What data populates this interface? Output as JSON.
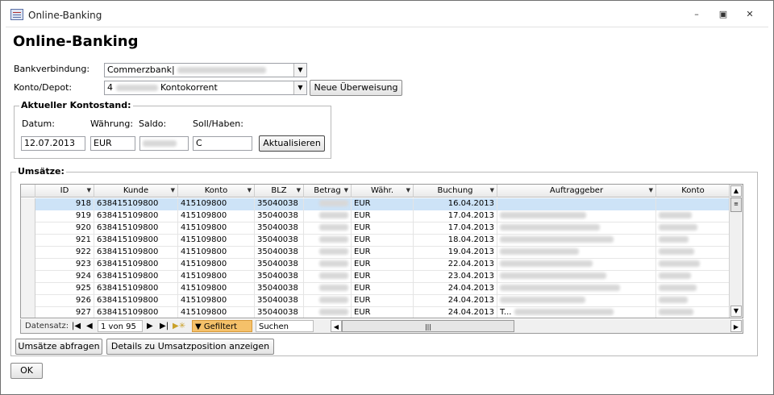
{
  "window": {
    "title": "Online-Banking"
  },
  "page": {
    "title": "Online-Banking"
  },
  "form": {
    "bank_label": "Bankverbindung:",
    "bank_value": "Commerzbank|",
    "account_label": "Konto/Depot:",
    "account_prefix": "4",
    "account_value": "Kontokorrent",
    "new_transfer_button": "Neue Überweisung"
  },
  "balance": {
    "group_title": "Aktueller Kontostand:",
    "date_label": "Datum:",
    "currency_label": "Währung:",
    "saldo_label": "Saldo:",
    "debit_credit_label": "Soll/Haben:",
    "date_value": "12.07.2013",
    "currency_value": "EUR",
    "debit_credit_value": "C",
    "refresh_button": "Aktualisieren"
  },
  "transactions": {
    "group_title": "Umsätze:",
    "columns": [
      "ID",
      "Kunde",
      "Konto",
      "BLZ",
      "Betrag",
      "Währ.",
      "Buchung",
      "Auftraggeber",
      "Konto"
    ],
    "rows": [
      {
        "id": "918",
        "kunde": "638415109800",
        "konto": "415109800",
        "blz": "35040038",
        "waehr": "EUR",
        "buchung": "16.04.2013",
        "auftraggeber": ""
      },
      {
        "id": "919",
        "kunde": "638415109800",
        "konto": "415109800",
        "blz": "35040038",
        "waehr": "EUR",
        "buchung": "17.04.2013",
        "auftraggeber": ""
      },
      {
        "id": "920",
        "kunde": "638415109800",
        "konto": "415109800",
        "blz": "35040038",
        "waehr": "EUR",
        "buchung": "17.04.2013",
        "auftraggeber": ""
      },
      {
        "id": "921",
        "kunde": "638415109800",
        "konto": "415109800",
        "blz": "35040038",
        "waehr": "EUR",
        "buchung": "18.04.2013",
        "auftraggeber": ""
      },
      {
        "id": "922",
        "kunde": "638415109800",
        "konto": "415109800",
        "blz": "35040038",
        "waehr": "EUR",
        "buchung": "19.04.2013",
        "auftraggeber": ""
      },
      {
        "id": "923",
        "kunde": "638415109800",
        "konto": "415109800",
        "blz": "35040038",
        "waehr": "EUR",
        "buchung": "22.04.2013",
        "auftraggeber": ""
      },
      {
        "id": "924",
        "kunde": "638415109800",
        "konto": "415109800",
        "blz": "35040038",
        "waehr": "EUR",
        "buchung": "23.04.2013",
        "auftraggeber": ""
      },
      {
        "id": "925",
        "kunde": "638415109800",
        "konto": "415109800",
        "blz": "35040038",
        "waehr": "EUR",
        "buchung": "24.04.2013",
        "auftraggeber": ""
      },
      {
        "id": "926",
        "kunde": "638415109800",
        "konto": "415109800",
        "blz": "35040038",
        "waehr": "EUR",
        "buchung": "24.04.2013",
        "auftraggeber": ""
      },
      {
        "id": "927",
        "kunde": "638415109800",
        "konto": "415109800",
        "blz": "35040038",
        "waehr": "EUR",
        "buchung": "24.04.2013",
        "auftraggeber": "T..."
      }
    ],
    "selected_row_index": 0
  },
  "navigator": {
    "label": "Datensatz:",
    "position": "1 von 95",
    "filter_label": "Gefiltert",
    "search_label": "Suchen"
  },
  "actions": {
    "query_button": "Umsätze abfragen",
    "details_button": "Details zu Umsatzposition anzeigen",
    "ok_button": "OK"
  },
  "colors": {
    "selected_row": "#cde3f7",
    "filter_badge": "#f5c16a"
  }
}
